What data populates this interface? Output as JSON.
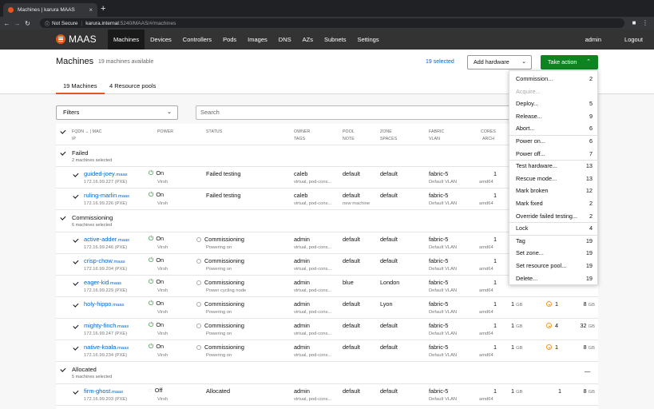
{
  "browser": {
    "tab_title": "Machines | karura MAAS",
    "security": "Not Secure",
    "host": "karura.internal",
    "path": ":5240/MAAS/#/machines"
  },
  "app": {
    "logo_text": "MAAS",
    "nav": [
      "Machines",
      "Devices",
      "Controllers",
      "Pods",
      "Images",
      "DNS",
      "AZs",
      "Subnets",
      "Settings"
    ],
    "user": "admin",
    "logout": "Logout"
  },
  "page": {
    "title": "Machines",
    "subtitle": "19 machines available",
    "selected": "19 selected",
    "add_hardware": "Add hardware",
    "take_action": "Take action",
    "tabs": [
      "19 Machines",
      "4 Resource pools"
    ]
  },
  "filters": {
    "label": "Filters",
    "search_placeholder": "Search"
  },
  "table_header": {
    "fqdn": "FQDN",
    "mac": "| MAC",
    "ip": "IP",
    "power": "POWER",
    "status": "STATUS",
    "owner": "OWNER",
    "tags": "TAGS",
    "pool": "POOL",
    "note": "NOTE",
    "zone": "ZONE",
    "spaces": "SPACES",
    "fabric": "FABRIC",
    "vlan": "VLAN",
    "cores": "CORES",
    "arch": "ARCH"
  },
  "groups": {
    "failed": {
      "name": "Failed",
      "sub": "2 machines selected"
    },
    "commissioning": {
      "name": "Commissioning",
      "sub": "6 machines selected"
    },
    "allocated": {
      "name": "Allocated",
      "sub": "5 machines selected",
      "toggle": "—"
    }
  },
  "machines": [
    {
      "host": "guided-joey",
      "domain": ".maas",
      "ip": "172.16.99.227 (PXE)",
      "power": "On",
      "power_type": "Virsh",
      "status": "Failed testing",
      "status_sub": "",
      "owner": "caleb",
      "tags": "virtual, pod-cons...",
      "pool": "default",
      "note": "",
      "zone": "default",
      "fabric": "fabric-5",
      "vlan": "Default VLAN",
      "cores": "1",
      "arch": "amd64",
      "ram": "",
      "disks": "",
      "storage": "",
      "storage_unit": ""
    },
    {
      "host": "ruling-marlin",
      "domain": ".maas",
      "ip": "172.16.99.226 (PXE)",
      "power": "On",
      "power_type": "Virsh",
      "status": "Failed testing",
      "status_sub": "",
      "owner": "caleb",
      "tags": "virtual, pod-cons...",
      "pool": "default",
      "note": "new machine",
      "zone": "default",
      "fabric": "fabric-5",
      "vlan": "Default VLAN",
      "cores": "1",
      "arch": "amd64",
      "ram": "",
      "disks": "",
      "storage": "",
      "storage_unit": ""
    },
    {
      "host": "active-adder",
      "domain": ".maas",
      "ip": "172.16.99.246 (PXE)",
      "power": "On",
      "power_type": "Virsh",
      "status": "Commissioning",
      "status_sub": "Powering on",
      "owner": "admin",
      "tags": "virtual, pod-cons...",
      "pool": "default",
      "note": "",
      "zone": "default",
      "fabric": "fabric-5",
      "vlan": "Default VLAN",
      "cores": "1",
      "arch": "amd64",
      "ram": "",
      "disks": "",
      "storage": "",
      "storage_unit": ""
    },
    {
      "host": "crisp-chow",
      "domain": ".maas",
      "ip": "172.16.99.204 (PXE)",
      "power": "On",
      "power_type": "Virsh",
      "status": "Commissioning",
      "status_sub": "Powering on",
      "owner": "admin",
      "tags": "virtual, pod-cons...",
      "pool": "default",
      "note": "",
      "zone": "default",
      "fabric": "fabric-5",
      "vlan": "Default VLAN",
      "cores": "1",
      "arch": "amd64",
      "ram": "",
      "disks": "",
      "storage": "",
      "storage_unit": ""
    },
    {
      "host": "eager-kid",
      "domain": ".maas",
      "ip": "172.16.99.229 (PXE)",
      "power": "On",
      "power_type": "Virsh",
      "status": "Commissioning",
      "status_sub": "Power cycling node",
      "owner": "admin",
      "tags": "virtual, pod-cons...",
      "pool": "blue",
      "note": "",
      "zone": "London",
      "fabric": "fabric-5",
      "vlan": "Default VLAN",
      "cores": "1",
      "arch": "amd64",
      "ram": "",
      "disks": "",
      "storage": "8",
      "storage_unit": "GB"
    },
    {
      "host": "holy-hippo",
      "domain": ".maas",
      "ip": "",
      "power": "On",
      "power_type": "Virsh",
      "status": "Commissioning",
      "status_sub": "Powering on",
      "owner": "admin",
      "tags": "virtual, pod-cons...",
      "pool": "default",
      "note": "",
      "zone": "Lyon",
      "fabric": "fabric-5",
      "vlan": "Default VLAN",
      "cores": "1",
      "arch": "amd64",
      "ram": "1",
      "disks": "1",
      "storage": "8",
      "storage_unit": "GB"
    },
    {
      "host": "mighty-finch",
      "domain": ".maas",
      "ip": "172.16.99.247 (PXE)",
      "power": "On",
      "power_type": "Virsh",
      "status": "Commissioning",
      "status_sub": "Powering on",
      "owner": "admin",
      "tags": "virtual, pod-cons...",
      "pool": "default",
      "note": "",
      "zone": "default",
      "fabric": "fabric-5",
      "vlan": "Default VLAN",
      "cores": "1",
      "arch": "amd64",
      "ram": "1",
      "disks": "4",
      "storage": "32",
      "storage_unit": "GB"
    },
    {
      "host": "native-koala",
      "domain": ".maas",
      "ip": "172.16.99.234 (PXE)",
      "power": "On",
      "power_type": "Virsh",
      "status": "Commissioning",
      "status_sub": "Powering on",
      "owner": "admin",
      "tags": "virtual, pod-cons...",
      "pool": "default",
      "note": "",
      "zone": "default",
      "fabric": "fabric-5",
      "vlan": "Default VLAN",
      "cores": "1",
      "arch": "amd64",
      "ram": "1",
      "disks": "1",
      "storage": "8",
      "storage_unit": "GB"
    },
    {
      "host": "firm-ghost",
      "domain": ".maas",
      "ip": "172.16.99.203 (PXE)",
      "power": "Off",
      "power_type": "Virsh",
      "status": "Allocated",
      "status_sub": "",
      "owner": "admin",
      "tags": "virtual, pod-cons...",
      "pool": "default",
      "note": "",
      "zone": "default",
      "fabric": "fabric-5",
      "vlan": "Default VLAN",
      "cores": "1",
      "arch": "amd64",
      "ram": "1",
      "disks": "1",
      "storage": "8",
      "storage_unit": "GB"
    }
  ],
  "units": {
    "ram": "GB"
  },
  "actions": [
    {
      "label": "Commission...",
      "count": "2"
    },
    {
      "label": "Acquire...",
      "count": ""
    },
    {
      "label": "Deploy...",
      "count": "5"
    },
    {
      "label": "Release...",
      "count": "9"
    },
    {
      "label": "Abort...",
      "count": "6"
    },
    {
      "label": "Power on...",
      "count": "6"
    },
    {
      "label": "Power off...",
      "count": "7"
    },
    {
      "label": "Test hardware...",
      "count": "13"
    },
    {
      "label": "Rescue mode...",
      "count": "13"
    },
    {
      "label": "Mark broken",
      "count": "12"
    },
    {
      "label": "Mark fixed",
      "count": "2"
    },
    {
      "label": "Override failed testing...",
      "count": "2"
    },
    {
      "label": "Lock",
      "count": "4"
    },
    {
      "label": "Tag",
      "count": "19"
    },
    {
      "label": "Set zone...",
      "count": "19"
    },
    {
      "label": "Set resource pool...",
      "count": "19"
    },
    {
      "label": "Delete...",
      "count": "19"
    }
  ],
  "colors": {
    "brand": "#e95420",
    "action_green": "#0e8420",
    "link": "#0066cc",
    "header_bg": "#333333"
  }
}
